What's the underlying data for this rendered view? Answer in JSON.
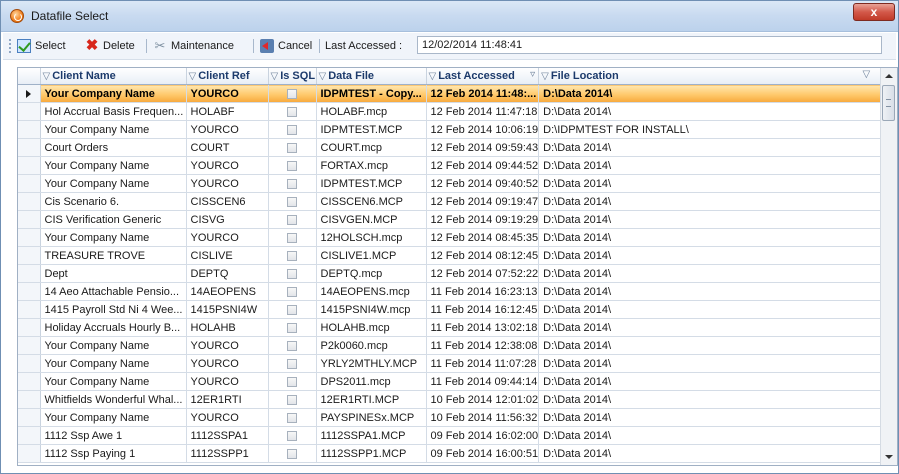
{
  "window": {
    "title": "Datafile Select",
    "close_label": "x"
  },
  "toolbar": {
    "select_label": "Select",
    "delete_label": "Delete",
    "maintenance_label": "Maintenance",
    "cancel_label": "Cancel",
    "last_accessed_label": "Last Accessed :",
    "last_accessed_value": "12/02/2014 11:48:41"
  },
  "grid": {
    "columns": [
      "Client Name",
      "Client Ref",
      "Is SQL",
      "Data File",
      "Last Accessed",
      "File Location"
    ],
    "rows": [
      {
        "client_name": "Your Company Name",
        "client_ref": "YOURCO",
        "is_sql": false,
        "data_file": "IDPMTEST - Copy...",
        "last_accessed": "12 Feb 2014 11:48:...",
        "file_location": "D:\\Data 2014\\",
        "selected": true
      },
      {
        "client_name": "Hol Accrual Basis Frequen...",
        "client_ref": "HOLABF",
        "is_sql": false,
        "data_file": "HOLABF.mcp",
        "last_accessed": "12 Feb 2014 11:47:18",
        "file_location": "D:\\Data 2014\\"
      },
      {
        "client_name": "Your Company Name",
        "client_ref": "YOURCO",
        "is_sql": false,
        "data_file": "IDPMTEST.MCP",
        "last_accessed": "12 Feb 2014 10:06:19",
        "file_location": "D:\\IDPMTEST FOR INSTALL\\"
      },
      {
        "client_name": "Court Orders",
        "client_ref": "COURT",
        "is_sql": false,
        "data_file": "COURT.mcp",
        "last_accessed": "12 Feb 2014 09:59:43",
        "file_location": "D:\\Data 2014\\"
      },
      {
        "client_name": "Your Company Name",
        "client_ref": "YOURCO",
        "is_sql": false,
        "data_file": "FORTAX.mcp",
        "last_accessed": "12 Feb 2014 09:44:52",
        "file_location": "D:\\Data 2014\\"
      },
      {
        "client_name": "Your Company Name",
        "client_ref": "YOURCO",
        "is_sql": false,
        "data_file": "IDPMTEST.MCP",
        "last_accessed": "12 Feb 2014 09:40:52",
        "file_location": "D:\\Data 2014\\"
      },
      {
        "client_name": "Cis Scenario 6.",
        "client_ref": "CISSCEN6",
        "is_sql": false,
        "data_file": "CISSCEN6.MCP",
        "last_accessed": "12 Feb 2014 09:19:47",
        "file_location": "D:\\Data 2014\\"
      },
      {
        "client_name": "CIS Verification Generic",
        "client_ref": "CISVG",
        "is_sql": false,
        "data_file": "CISVGEN.MCP",
        "last_accessed": "12 Feb 2014 09:19:29",
        "file_location": "D:\\Data 2014\\"
      },
      {
        "client_name": "Your Company Name",
        "client_ref": "YOURCO",
        "is_sql": false,
        "data_file": "12HOLSCH.mcp",
        "last_accessed": "12 Feb 2014 08:45:35",
        "file_location": "D:\\Data 2014\\"
      },
      {
        "client_name": "TREASURE TROVE",
        "client_ref": "CISLIVE",
        "is_sql": false,
        "data_file": "CISLIVE1.MCP",
        "last_accessed": "12 Feb 2014 08:12:45",
        "file_location": "D:\\Data 2014\\"
      },
      {
        "client_name": "Dept",
        "client_ref": "DEPTQ",
        "is_sql": false,
        "data_file": "DEPTQ.mcp",
        "last_accessed": "12 Feb 2014 07:52:22",
        "file_location": "D:\\Data 2014\\"
      },
      {
        "client_name": "14 Aeo Attachable Pensio...",
        "client_ref": "14AEOPENS",
        "is_sql": false,
        "data_file": "14AEOPENS.mcp",
        "last_accessed": "11 Feb 2014 16:23:13",
        "file_location": "D:\\Data 2014\\"
      },
      {
        "client_name": "1415 Payroll Std Ni 4 Wee...",
        "client_ref": "1415PSNI4W",
        "is_sql": false,
        "data_file": "1415PSNI4W.mcp",
        "last_accessed": "11 Feb 2014 16:12:45",
        "file_location": "D:\\Data 2014\\"
      },
      {
        "client_name": "Holiday Accruals Hourly B...",
        "client_ref": "HOLAHB",
        "is_sql": false,
        "data_file": "HOLAHB.mcp",
        "last_accessed": "11 Feb 2014 13:02:18",
        "file_location": "D:\\Data 2014\\"
      },
      {
        "client_name": "Your Company Name",
        "client_ref": "YOURCO",
        "is_sql": false,
        "data_file": "P2k0060.mcp",
        "last_accessed": "11 Feb 2014 12:38:08",
        "file_location": "D:\\Data 2014\\"
      },
      {
        "client_name": "Your Company Name",
        "client_ref": "YOURCO",
        "is_sql": false,
        "data_file": "YRLY2MTHLY.MCP",
        "last_accessed": "11 Feb 2014 11:07:28",
        "file_location": "D:\\Data 2014\\"
      },
      {
        "client_name": "Your Company Name",
        "client_ref": "YOURCO",
        "is_sql": false,
        "data_file": "DPS2011.mcp",
        "last_accessed": "11 Feb 2014 09:44:14",
        "file_location": "D:\\Data 2014\\"
      },
      {
        "client_name": "Whitfields Wonderful Whal...",
        "client_ref": "12ER1RTI",
        "is_sql": false,
        "data_file": "12ER1RTI.MCP",
        "last_accessed": "10 Feb 2014 12:01:02",
        "file_location": "D:\\Data 2014\\"
      },
      {
        "client_name": "Your Company Name",
        "client_ref": "YOURCO",
        "is_sql": false,
        "data_file": "PAYSPINESx.MCP",
        "last_accessed": "10 Feb 2014 11:56:32",
        "file_location": "D:\\Data 2014\\"
      },
      {
        "client_name": "1112 Ssp Awe 1",
        "client_ref": "1112SSPA1",
        "is_sql": false,
        "data_file": "1112SSPA1.MCP",
        "last_accessed": "09 Feb 2014 16:02:00",
        "file_location": "D:\\Data 2014\\"
      },
      {
        "client_name": "1112 Ssp Paying 1",
        "client_ref": "1112SSPP1",
        "is_sql": false,
        "data_file": "1112SSPP1.MCP",
        "last_accessed": "09 Feb 2014 16:00:51",
        "file_location": "D:\\Data 2014\\"
      }
    ]
  }
}
